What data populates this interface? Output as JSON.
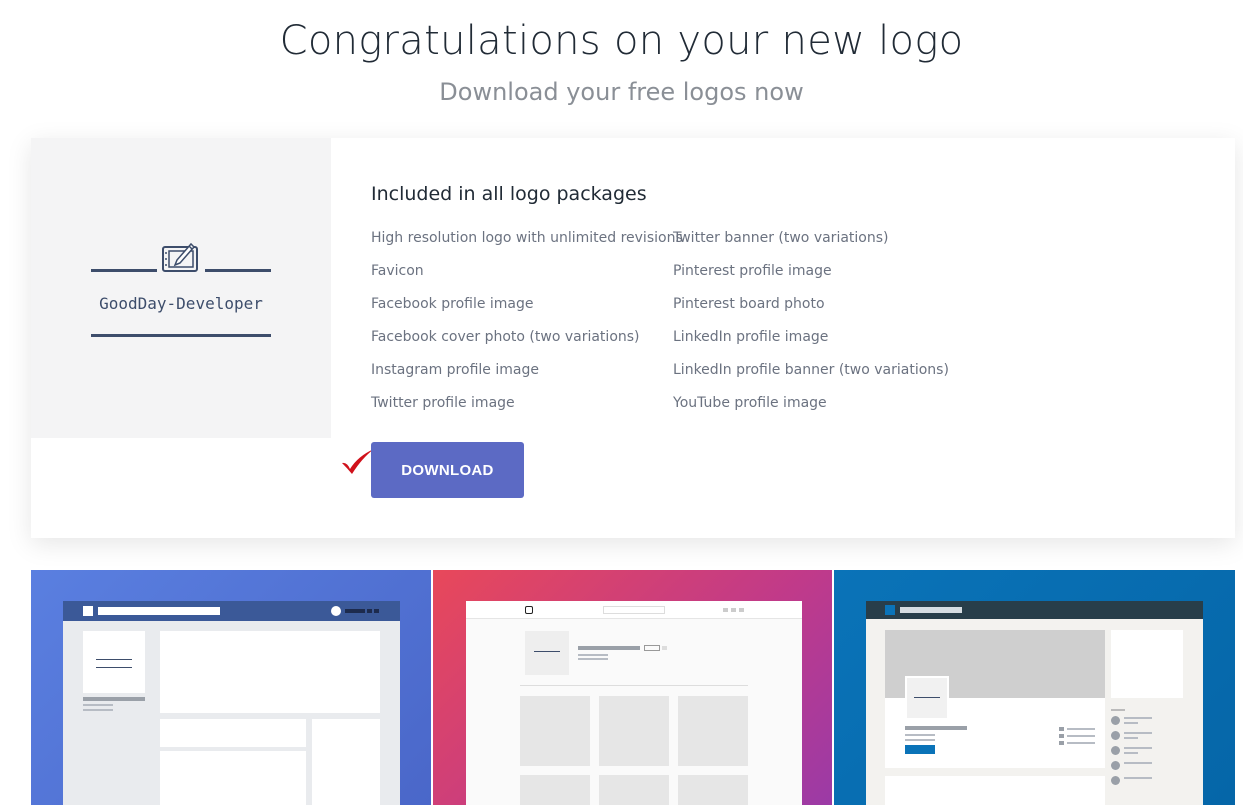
{
  "header": {
    "title": "Congratulations on your new logo",
    "subtitle": "Download your free logos now"
  },
  "logo": {
    "text": "GoodDay-Developer",
    "icon": "drawing-tablet-pen-icon",
    "color": "#3d4d6b"
  },
  "package": {
    "title": "Included in all logo packages",
    "items_left": [
      "High resolution logo with unlimited revisions",
      "Favicon",
      "Facebook profile image",
      "Facebook cover photo (two variations)",
      "Instagram profile image",
      "Twitter profile image"
    ],
    "items_right": [
      "Twitter banner (two variations)",
      "Pinterest profile image",
      "Pinterest board photo",
      "LinkedIn profile image",
      "LinkedIn profile banner (two variations)",
      "YouTube profile image"
    ]
  },
  "download": {
    "label": "DOWNLOAD",
    "color": "#5c6ac4",
    "check_icon": "red-checkmark-icon",
    "check_color": "#d0111b"
  },
  "previews": [
    {
      "name": "facebook-preview",
      "colors": [
        "#5a7fe0",
        "#4a67c9"
      ]
    },
    {
      "name": "instagram-preview",
      "colors": [
        "#e8485a",
        "#9b3aa6"
      ]
    },
    {
      "name": "linkedin-preview",
      "colors": [
        "#0a73b8",
        "#0566a8"
      ]
    }
  ]
}
